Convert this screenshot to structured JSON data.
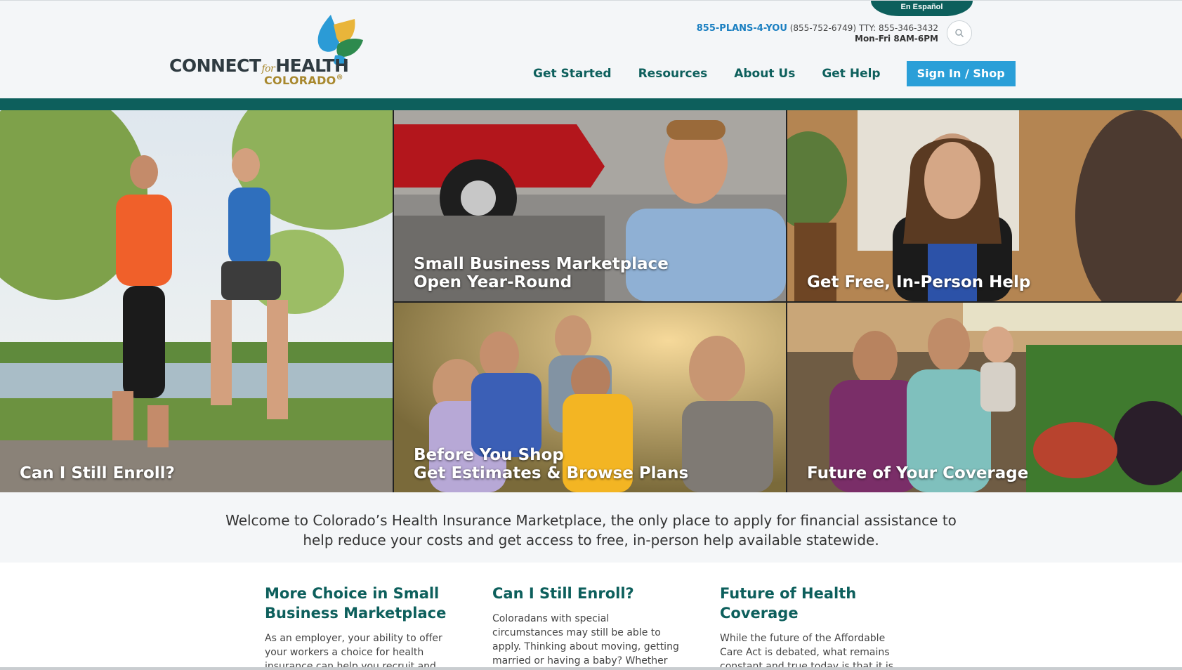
{
  "header": {
    "language_link": "En Español",
    "logo": {
      "connect": "CONNECT",
      "for": "for",
      "health": "HEALTH",
      "colorado": "COLORADO",
      "registered": "®"
    },
    "phone_brand": "855-PLANS-4-YOU",
    "phone_number": "(855-752-6749)",
    "tty": "TTY: 855-346-3432",
    "hours": "Mon-Fri 8AM-6PM",
    "search_icon": "search-icon"
  },
  "nav": {
    "items": [
      {
        "label": "Get Started"
      },
      {
        "label": "Resources"
      },
      {
        "label": "About Us"
      },
      {
        "label": "Get Help"
      }
    ],
    "cta": "Sign In / Shop"
  },
  "hero": {
    "tiles": [
      {
        "caption_line1": "Can I Still Enroll?",
        "caption_line2": ""
      },
      {
        "caption_line1": "Small Business Marketplace",
        "caption_line2": "Open Year-Round"
      },
      {
        "caption_line1": "Get Free, In-Person Help",
        "caption_line2": ""
      },
      {
        "caption_line1": "Before You Shop",
        "caption_line2": "Get Estimates & Browse Plans"
      },
      {
        "caption_line1": "Future of Your Coverage",
        "caption_line2": ""
      }
    ]
  },
  "welcome": {
    "text": "Welcome to Colorado’s Health Insurance Marketplace, the only place to apply for financial assistance to help reduce your costs and get access to free, in-person help available statewide."
  },
  "columns": [
    {
      "title": "More Choice in Small Business Marketplace",
      "body": "As an employer, your ability to offer your workers a choice for health insurance can help you recruit and"
    },
    {
      "title": "Can I Still Enroll?",
      "body": "Coloradans with special circumstances may still be able to apply. Thinking about moving, getting married or having a baby? Whether you are a new"
    },
    {
      "title": "Future of Health Coverage",
      "body": "While the future of the Affordable Care Act is debated, what remains constant and true today is that it is important to protect the health and financial future"
    }
  ],
  "colors": {
    "brand_teal": "#0d5f5c",
    "brand_blue": "#2a9fd8",
    "brand_gold": "#a8882e",
    "logo_leaf_blue": "#2b9bd6",
    "logo_leaf_gold": "#e9b53a",
    "logo_leaf_green": "#2d8a4e"
  }
}
